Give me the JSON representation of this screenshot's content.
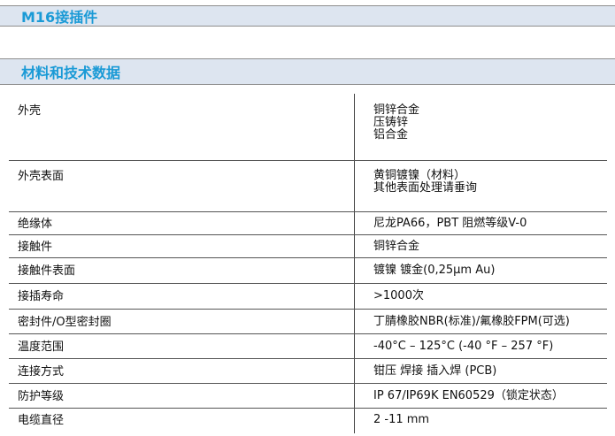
{
  "header": {
    "title": "M16接插件"
  },
  "section": {
    "title": "材料和技术数据"
  },
  "rows": [
    {
      "label": "外壳",
      "value_lines": [
        "铜锌合金",
        "压铸锌",
        "铝合金"
      ]
    },
    {
      "label": "外壳表面",
      "value_lines": [
        "黄铜镀镍（材料）",
        "其他表面处理请垂询"
      ]
    },
    {
      "label": "绝缘体",
      "value_lines": [
        "尼龙PA66，PBT  阻燃等级V-0"
      ]
    },
    {
      "label": "接触件",
      "value_lines": [
        "铜锌合金"
      ]
    },
    {
      "label": "接触件表面",
      "value_lines": [
        "镀镍 镀金(0,25μm Au)"
      ]
    },
    {
      "label": "接插寿命",
      "value_lines": [
        ">1000次"
      ]
    },
    {
      "label": "密封件/O型密封圈",
      "value_lines": [
        "丁腈橡胶NBR(标准)/氟橡胶FPM(可选)"
      ]
    },
    {
      "label": "温度范围",
      "value_lines": [
        "-40°C – 125°C (-40 °F – 257 °F)"
      ]
    },
    {
      "label": "连接方式",
      "value_lines": [
        "钳压 焊接 插入焊 (PCB)"
      ]
    },
    {
      "label": "防护等级",
      "value_lines": [
        "IP 67/IP69K EN60529（锁定状态）"
      ]
    },
    {
      "label": "电缆直径",
      "value_lines": [
        "2 -11 mm"
      ]
    }
  ]
}
